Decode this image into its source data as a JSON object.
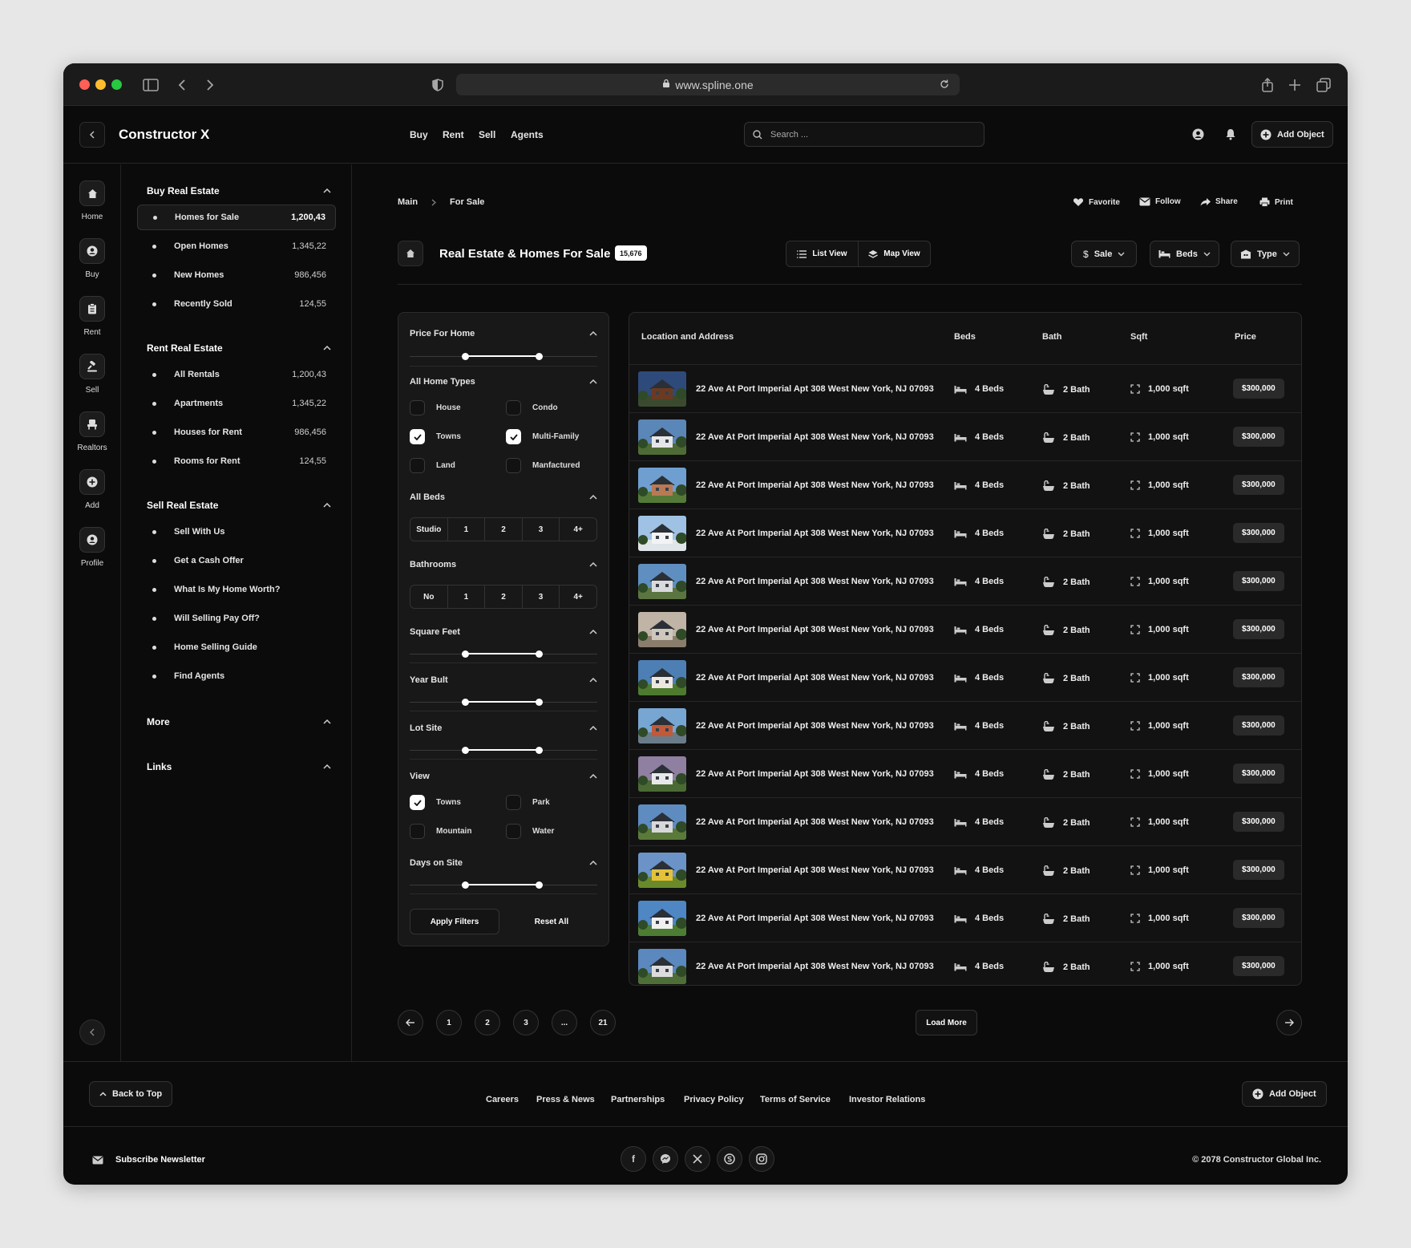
{
  "browser": {
    "url": "www.spline.one"
  },
  "app": {
    "title": "Constructor X"
  },
  "nav": {
    "items": [
      "Buy",
      "Rent",
      "Sell",
      "Agents"
    ]
  },
  "search": {
    "placeholder": "Search ..."
  },
  "header": {
    "add_object": "Add Object"
  },
  "rail": [
    "Home",
    "Buy",
    "Rent",
    "Sell",
    "Realtors",
    "Add",
    "Profile"
  ],
  "sidebar": {
    "buy": {
      "title": "Buy Real Estate",
      "items": [
        {
          "label": "Homes for Sale",
          "count": "1,200,43"
        },
        {
          "label": "Open Homes",
          "count": "1,345,22"
        },
        {
          "label": "New Homes",
          "count": "986,456"
        },
        {
          "label": "Recently Sold",
          "count": "124,55"
        }
      ]
    },
    "rent": {
      "title": "Rent Real Estate",
      "items": [
        {
          "label": "All Rentals",
          "count": "1,200,43"
        },
        {
          "label": "Apartments",
          "count": "1,345,22"
        },
        {
          "label": "Houses for Rent",
          "count": "986,456"
        },
        {
          "label": "Rooms for Rent",
          "count": "124,55"
        }
      ]
    },
    "sell": {
      "title": "Sell Real Estate",
      "items": [
        {
          "label": "Sell With Us"
        },
        {
          "label": "Get a Cash Offer"
        },
        {
          "label": "What Is My Home Worth?"
        },
        {
          "label": "Will Selling Pay Off?"
        },
        {
          "label": "Home Selling Guide"
        },
        {
          "label": "Find Agents"
        }
      ]
    },
    "more": "More",
    "links": "Links"
  },
  "breadcrumb": {
    "main": "Main",
    "current": "For Sale"
  },
  "actions": {
    "favorite": "Favorite",
    "follow": "Follow",
    "share": "Share",
    "print": "Print"
  },
  "page": {
    "title": "Real Estate & Homes For Sale",
    "count": "15,676"
  },
  "views": {
    "list": "List View",
    "map": "Map View"
  },
  "dropdowns": {
    "sale": "Sale",
    "beds": "Beds",
    "type": "Type"
  },
  "filters": {
    "price": "Price For Home",
    "home_types": {
      "title": "All Home Types",
      "options": [
        {
          "label": "House",
          "checked": false
        },
        {
          "label": "Condo",
          "checked": false
        },
        {
          "label": "Towns",
          "checked": true
        },
        {
          "label": "Multi-Family",
          "checked": true
        },
        {
          "label": "Land",
          "checked": false
        },
        {
          "label": "Manfactured",
          "checked": false
        }
      ]
    },
    "beds": {
      "title": "All Beds",
      "options": [
        "Studio",
        "1",
        "2",
        "3",
        "4+"
      ]
    },
    "baths": {
      "title": "Bathrooms",
      "options": [
        "No",
        "1",
        "2",
        "3",
        "4+"
      ]
    },
    "sqft": "Square Feet",
    "year": "Year Bult",
    "lot": "Lot Site",
    "view": {
      "title": "View",
      "options": [
        {
          "label": "Towns",
          "checked": true
        },
        {
          "label": "Park",
          "checked": false
        },
        {
          "label": "Mountain",
          "checked": false
        },
        {
          "label": "Water",
          "checked": false
        }
      ]
    },
    "days": "Days on Site",
    "apply": "Apply Filters",
    "reset": "Reset All"
  },
  "table": {
    "headers": {
      "location": "Location and Address",
      "beds": "Beds",
      "bath": "Bath",
      "sqft": "Sqft",
      "price": "Price"
    },
    "rows": [
      {
        "address": "22 Ave At Port Imperial Apt 308 West New York, NJ 07093",
        "beds": "4 Beds",
        "bath": "2 Bath",
        "sqft": "1,000 sqft",
        "price": "$300,000"
      },
      {
        "address": "22 Ave At Port Imperial Apt 308 West New York, NJ 07093",
        "beds": "4 Beds",
        "bath": "2 Bath",
        "sqft": "1,000 sqft",
        "price": "$300,000"
      },
      {
        "address": "22 Ave At Port Imperial Apt 308 West New York, NJ 07093",
        "beds": "4 Beds",
        "bath": "2 Bath",
        "sqft": "1,000 sqft",
        "price": "$300,000"
      },
      {
        "address": "22 Ave At Port Imperial Apt 308 West New York, NJ 07093",
        "beds": "4 Beds",
        "bath": "2 Bath",
        "sqft": "1,000 sqft",
        "price": "$300,000"
      },
      {
        "address": "22 Ave At Port Imperial Apt 308 West New York, NJ 07093",
        "beds": "4 Beds",
        "bath": "2 Bath",
        "sqft": "1,000 sqft",
        "price": "$300,000"
      },
      {
        "address": "22 Ave At Port Imperial Apt 308 West New York, NJ 07093",
        "beds": "4 Beds",
        "bath": "2 Bath",
        "sqft": "1,000 sqft",
        "price": "$300,000"
      },
      {
        "address": "22 Ave At Port Imperial Apt 308 West New York, NJ 07093",
        "beds": "4 Beds",
        "bath": "2 Bath",
        "sqft": "1,000 sqft",
        "price": "$300,000"
      },
      {
        "address": "22 Ave At Port Imperial Apt 308 West New York, NJ 07093",
        "beds": "4 Beds",
        "bath": "2 Bath",
        "sqft": "1,000 sqft",
        "price": "$300,000"
      },
      {
        "address": "22 Ave At Port Imperial Apt 308 West New York, NJ 07093",
        "beds": "4 Beds",
        "bath": "2 Bath",
        "sqft": "1,000 sqft",
        "price": "$300,000"
      },
      {
        "address": "22 Ave At Port Imperial Apt 308 West New York, NJ 07093",
        "beds": "4 Beds",
        "bath": "2 Bath",
        "sqft": "1,000 sqft",
        "price": "$300,000"
      },
      {
        "address": "22 Ave At Port Imperial Apt 308 West New York, NJ 07093",
        "beds": "4 Beds",
        "bath": "2 Bath",
        "sqft": "1,000 sqft",
        "price": "$300,000"
      },
      {
        "address": "22 Ave At Port Imperial Apt 308 West New York, NJ 07093",
        "beds": "4 Beds",
        "bath": "2 Bath",
        "sqft": "1,000 sqft",
        "price": "$300,000"
      },
      {
        "address": "22 Ave At Port Imperial Apt 308 West New York, NJ 07093",
        "beds": "4 Beds",
        "bath": "2 Bath",
        "sqft": "1,000 sqft",
        "price": "$300,000"
      }
    ]
  },
  "pagination": {
    "pages": [
      "1",
      "2",
      "3",
      "...",
      "21"
    ],
    "load_more": "Load More"
  },
  "footer": {
    "back_to_top": "Back to Top",
    "links": [
      "Careers",
      "Press & News",
      "Partnerships",
      "Privacy Policy",
      "Terms of Service",
      "Investor Relations"
    ],
    "add_object": "Add Object",
    "subscribe": "Subscribe Newsletter",
    "social": [
      "facebook-icon",
      "messenger-icon",
      "x-icon",
      "skype-icon",
      "instagram-icon"
    ],
    "copyright": "© 2078 Constructor Global Inc."
  },
  "colors": {
    "background": "#0b0b0b",
    "panel": "#181818",
    "accent": "#ffffff",
    "close": "#ff5f57",
    "minimize": "#febc2e",
    "zoom": "#28c840"
  }
}
